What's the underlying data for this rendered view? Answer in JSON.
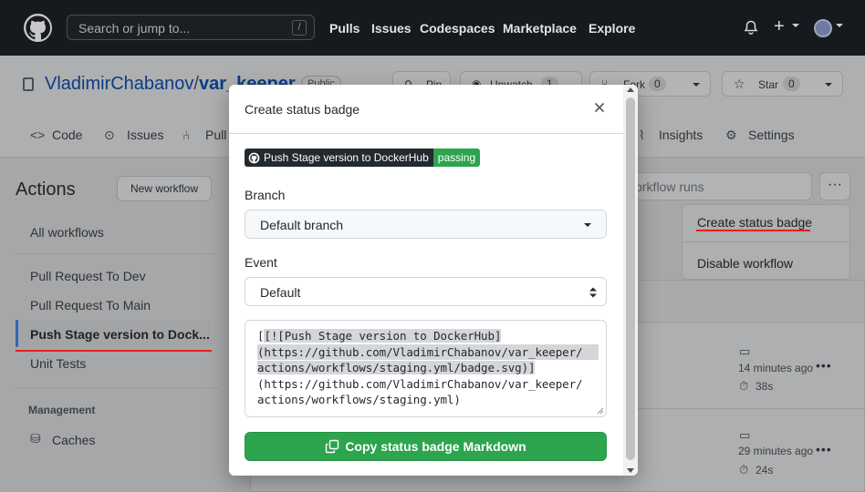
{
  "header": {
    "search_placeholder": "Search or jump to...",
    "search_shortcut": "/",
    "nav": [
      "Pulls",
      "Issues",
      "Codespaces",
      "Marketplace",
      "Explore"
    ]
  },
  "repo": {
    "owner": "VladimirChabanov",
    "separator": "/",
    "name": "var_keeper",
    "visibility": "Public",
    "pin_label": "Pin",
    "watch_label": "Unwatch",
    "watch_count": "1",
    "fork_label": "Fork",
    "fork_count": "0",
    "star_label": "Star",
    "star_count": "0"
  },
  "tabs": [
    "Code",
    "Issues",
    "Pull requests",
    "Insights",
    "Settings"
  ],
  "sidebar": {
    "heading": "Actions",
    "new_workflow": "New workflow",
    "all_workflows": "All workflows",
    "workflows": [
      "Pull Request To Dev",
      "Pull Request To Main",
      "Push Stage version to Dock...",
      "Unit Tests"
    ],
    "management_label": "Management",
    "caches": "Caches"
  },
  "main": {
    "filter_placeholder": "Filter workflow runs",
    "menu": {
      "create_badge": "Create status badge",
      "disable": "Disable workflow"
    },
    "runs": [
      {
        "time": "14 minutes ago",
        "duration": "38s"
      },
      {
        "time": "29 minutes ago",
        "duration": "24s"
      }
    ]
  },
  "modal": {
    "title": "Create status badge",
    "badge_workflow": "Push Stage version to DockerHub",
    "badge_status": "passing",
    "branch_label": "Branch",
    "branch_value": "Default branch",
    "event_label": "Event",
    "event_value": "Default",
    "markdown_lines": [
      "[![Push Stage version to DockerHub]",
      "(https://github.com/VladimirChabanov/var_keeper/",
      "actions/workflows/staging.yml/badge.svg)]",
      "(https://github.com/VladimirChabanov/var_keeper/",
      "actions/workflows/staging.yml)"
    ],
    "copy_button": "Copy status badge Markdown"
  },
  "colors": {
    "primary_green": "#2da44e",
    "annotation_red": "#e0221a",
    "link_blue": "#0b3c85"
  }
}
